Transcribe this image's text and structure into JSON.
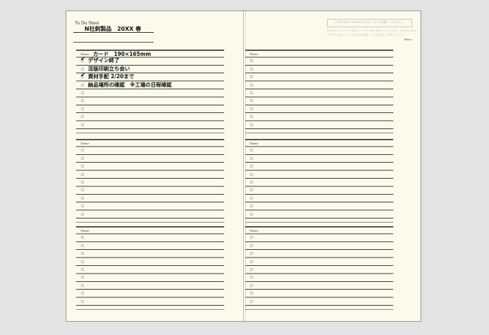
{
  "sheet": {
    "title": "To Do Sheet",
    "subtitle": "N社刺製品　20XX 春",
    "memo_label": "Memo",
    "right_box_text": "このProject Sheetをコピーしてお使いください。",
    "right_note": "各テキストをコピーするなど、マーカー並びを使ってメモします。 Project Sheetの下方外の目にコピーするなどの場合、これらを使いご利用ください。"
  },
  "theme_label": "Theme",
  "sections": [
    {
      "theme": "カード　190×165mm",
      "rows": [
        {
          "checked": true,
          "text": "デザイン終了"
        },
        {
          "checked": false,
          "text": "活版印刷立ち会い"
        },
        {
          "checked": true,
          "text": "資材手配 2/20まで"
        },
        {
          "checked": false,
          "text": "納品場所の確認　※工場の日程確認"
        },
        {
          "checked": false,
          "text": ""
        },
        {
          "checked": false,
          "text": ""
        },
        {
          "checked": false,
          "text": ""
        },
        {
          "checked": false,
          "text": ""
        },
        {
          "checked": false,
          "text": ""
        }
      ]
    },
    {
      "theme": "",
      "rows": [
        {
          "checked": false,
          "text": ""
        },
        {
          "checked": false,
          "text": ""
        },
        {
          "checked": false,
          "text": ""
        },
        {
          "checked": false,
          "text": ""
        },
        {
          "checked": false,
          "text": ""
        },
        {
          "checked": false,
          "text": ""
        },
        {
          "checked": false,
          "text": ""
        },
        {
          "checked": false,
          "text": ""
        },
        {
          "checked": false,
          "text": ""
        }
      ]
    },
    {
      "theme": "",
      "rows": [
        {
          "checked": false,
          "text": ""
        },
        {
          "checked": false,
          "text": ""
        },
        {
          "checked": false,
          "text": ""
        },
        {
          "checked": false,
          "text": ""
        },
        {
          "checked": false,
          "text": ""
        },
        {
          "checked": false,
          "text": ""
        },
        {
          "checked": false,
          "text": ""
        },
        {
          "checked": false,
          "text": ""
        },
        {
          "checked": false,
          "text": ""
        }
      ]
    },
    {
      "theme": "",
      "rows": [
        {
          "checked": false,
          "text": ""
        },
        {
          "checked": false,
          "text": ""
        },
        {
          "checked": false,
          "text": ""
        },
        {
          "checked": false,
          "text": ""
        },
        {
          "checked": false,
          "text": ""
        },
        {
          "checked": false,
          "text": ""
        },
        {
          "checked": false,
          "text": ""
        },
        {
          "checked": false,
          "text": ""
        },
        {
          "checked": false,
          "text": ""
        }
      ]
    },
    {
      "theme": "",
      "rows": [
        {
          "checked": false,
          "text": ""
        },
        {
          "checked": false,
          "text": ""
        },
        {
          "checked": false,
          "text": ""
        },
        {
          "checked": false,
          "text": ""
        },
        {
          "checked": false,
          "text": ""
        },
        {
          "checked": false,
          "text": ""
        },
        {
          "checked": false,
          "text": ""
        },
        {
          "checked": false,
          "text": ""
        },
        {
          "checked": false,
          "text": ""
        }
      ]
    },
    {
      "theme": "",
      "rows": [
        {
          "checked": false,
          "text": ""
        },
        {
          "checked": false,
          "text": ""
        },
        {
          "checked": false,
          "text": ""
        },
        {
          "checked": false,
          "text": ""
        },
        {
          "checked": false,
          "text": ""
        },
        {
          "checked": false,
          "text": ""
        },
        {
          "checked": false,
          "text": ""
        },
        {
          "checked": false,
          "text": ""
        },
        {
          "checked": false,
          "text": ""
        }
      ]
    }
  ]
}
